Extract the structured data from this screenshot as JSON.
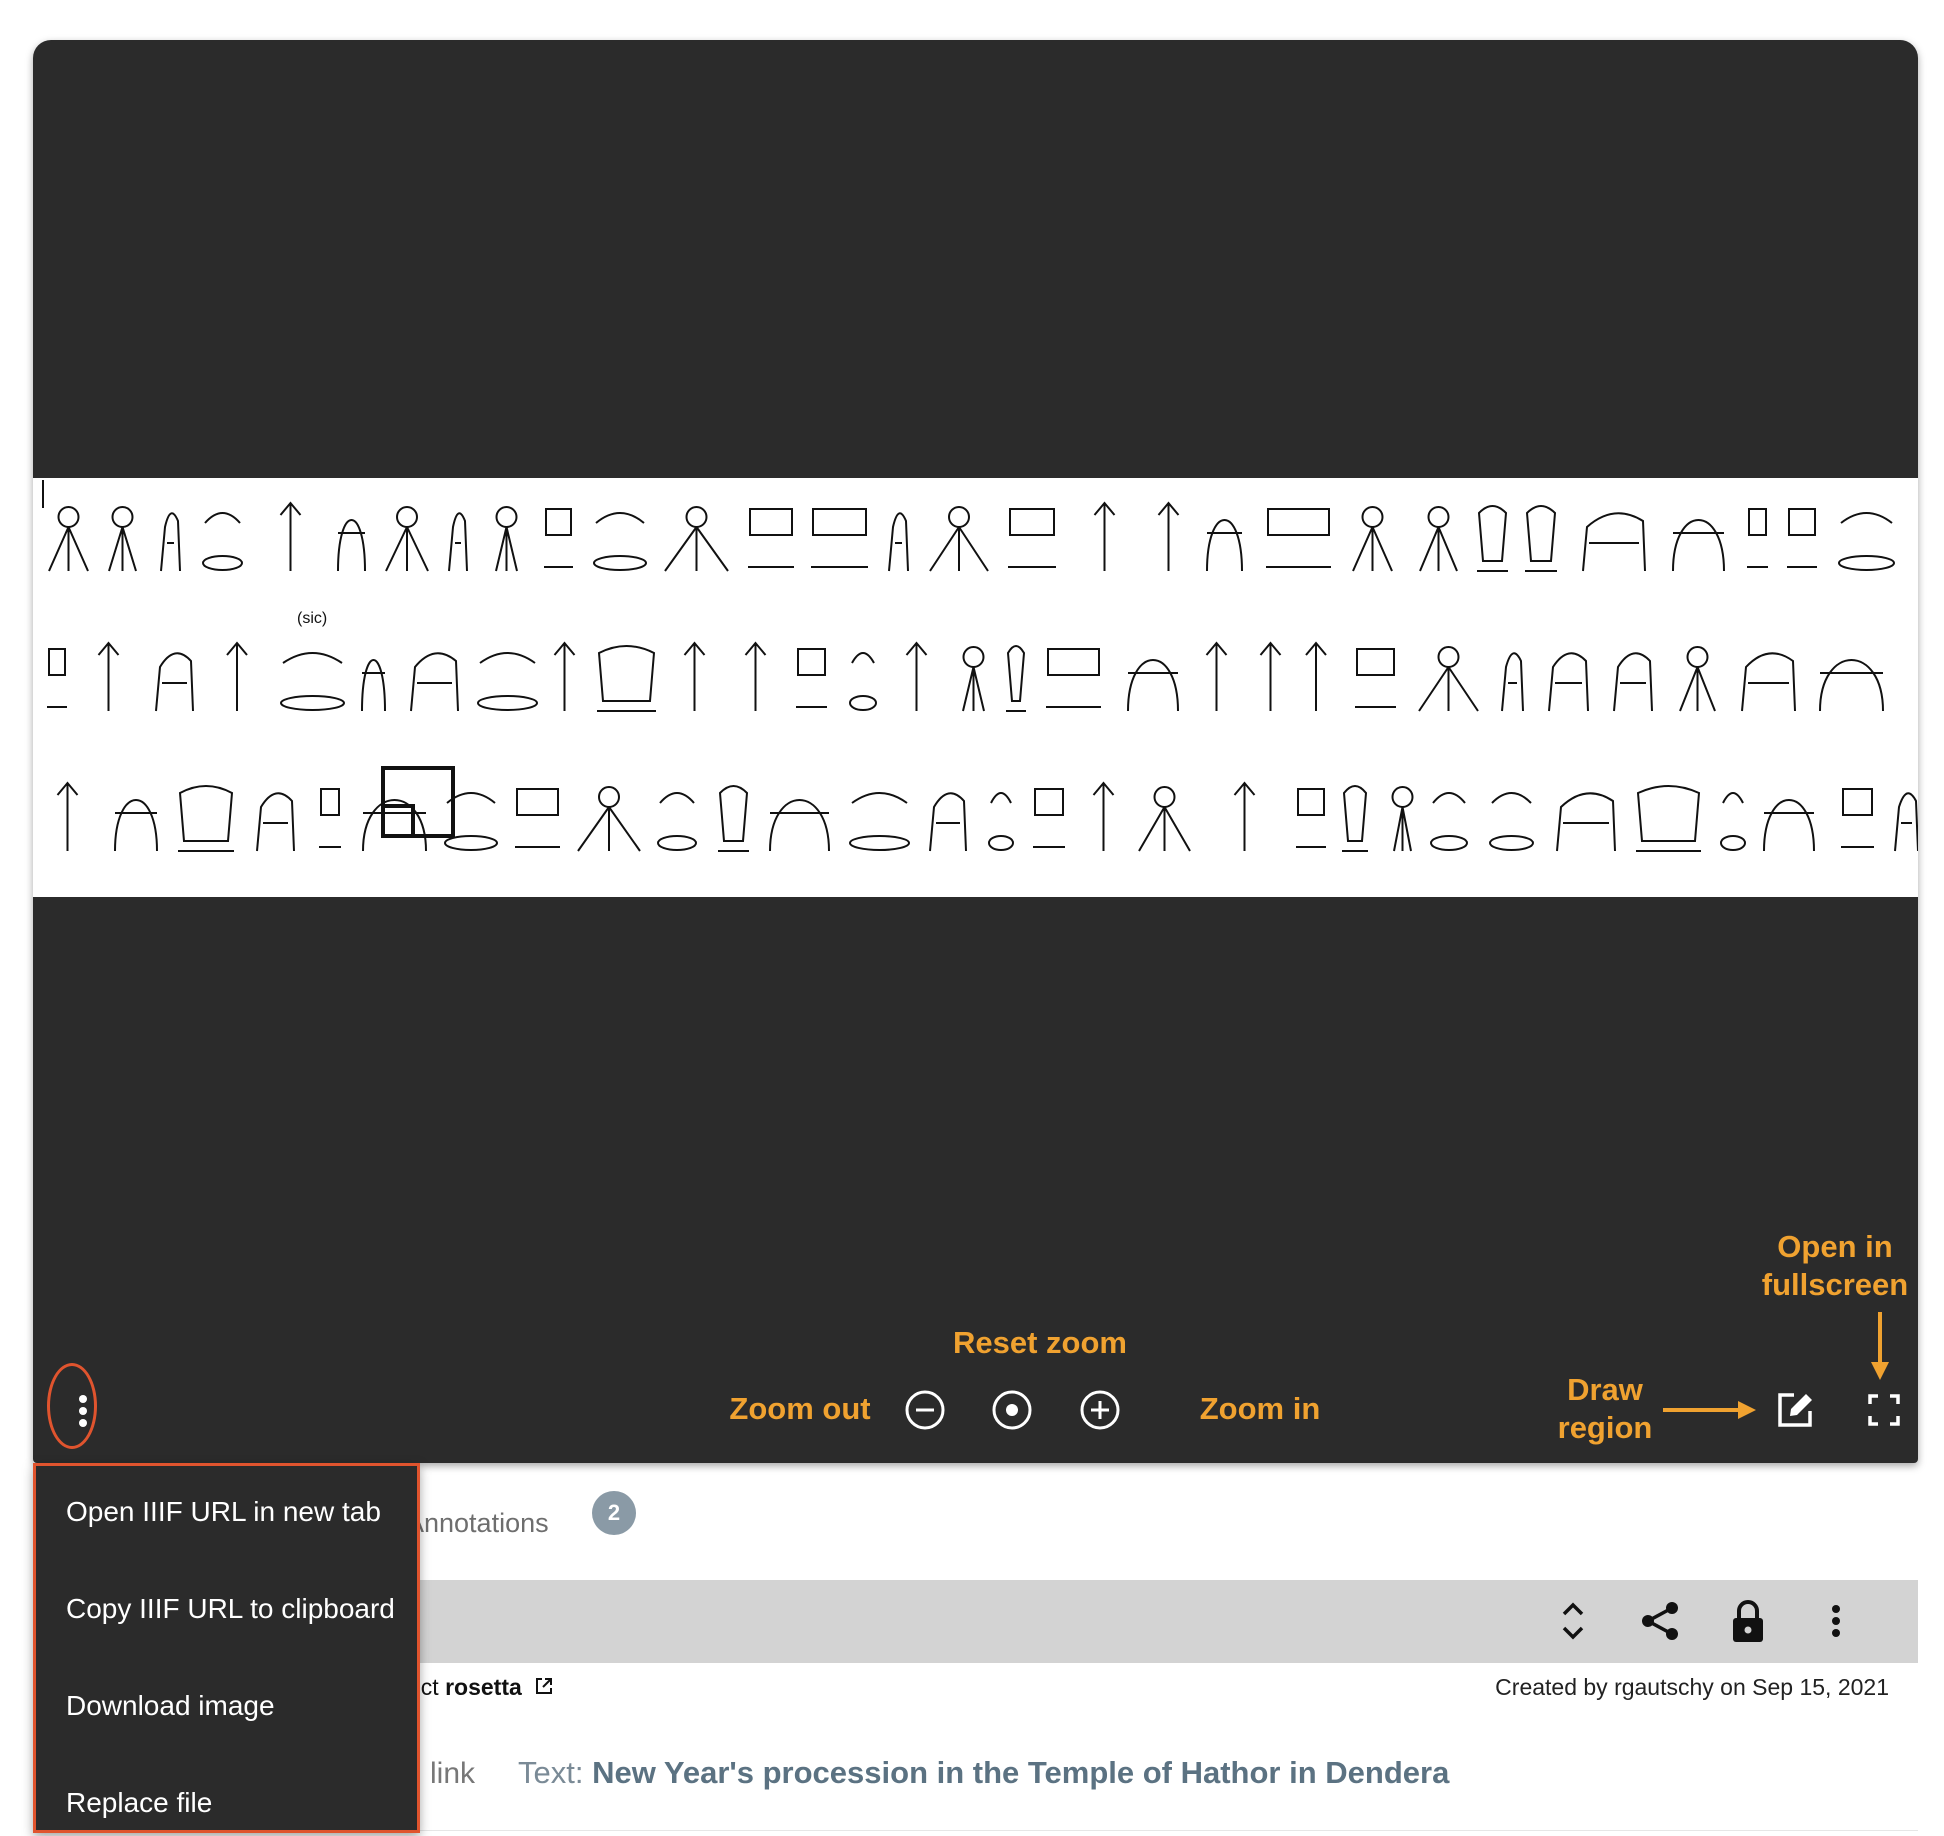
{
  "viewer": {
    "toolbar": {
      "menu_icon": "more-vert-icon",
      "zoom_out_icon": "minus-circle-icon",
      "reset_zoom_icon": "target-circle-icon",
      "zoom_in_icon": "plus-circle-icon",
      "draw_region_icon": "edit-square-icon",
      "fullscreen_icon": "fullscreen-icon"
    },
    "annotations": {
      "reset_zoom": "Reset zoom",
      "zoom_out": "Zoom out",
      "zoom_in": "Zoom in",
      "draw_region_line1": "Draw",
      "draw_region_line2": "region",
      "fullscreen_line1": "Open in",
      "fullscreen_line2": "fullscreen"
    },
    "image_caption": "(sic)"
  },
  "context_menu": {
    "items": [
      "Open IIIF URL in new tab",
      "Copy IIIF URL to clipboard",
      "Download image",
      "Replace file"
    ]
  },
  "tabs": {
    "annotations_label": "Annotations",
    "annotations_count": "2"
  },
  "resource_bar": {
    "icons": [
      "unfold-icon",
      "share-icon",
      "lock-icon",
      "more-vert-icon"
    ]
  },
  "resource_info": {
    "project_prefix": "ect ",
    "project_name": "rosetta",
    "created_by": "Created by rgautschy on Sep 15, 2021",
    "link_label": "link",
    "text_prefix": "Text: ",
    "text_title": "New Year's procession in the Temple of Hathor in Dendera"
  },
  "colors": {
    "viewer_bg": "#2b2b2b",
    "annotation": "#f0a230",
    "highlight": "#e0542e",
    "badge": "#8a9aa6"
  }
}
